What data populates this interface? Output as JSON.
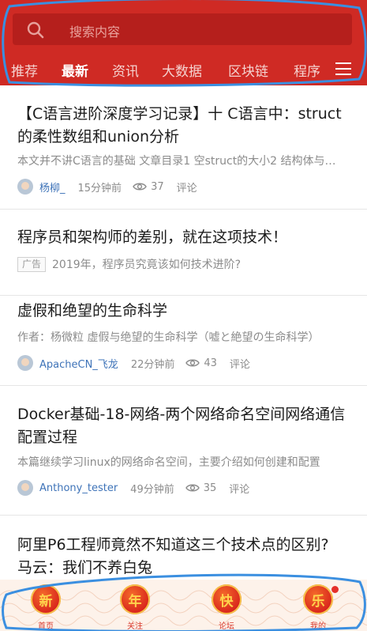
{
  "search": {
    "placeholder": "搜索内容"
  },
  "tabs": [
    "推荐",
    "最新",
    "资讯",
    "大数据",
    "区块链",
    "程序"
  ],
  "active_tab": "最新",
  "feed": [
    {
      "title": "【C语言进阶深度学习记录】十 C语言中：struct的柔性数组和union分析",
      "summary": "本文并不讲C语言的基础 文章目录1 空struct的大小2 结构体与柔性数组",
      "author": "杨柳_",
      "time": "15分钟前",
      "views": "37",
      "comment": "评论"
    },
    {
      "title": "程序员和架构师的差别，就在这项技术！",
      "ad_label": "广告",
      "summary": "2019年，程序员究竟该如何技术进阶?"
    },
    {
      "title": "虚假和绝望的生命科学",
      "summary": "作者：杨微粒 虚假与绝望的生命科学（嘘と絶望の生命科学）",
      "author": "ApacheCN_飞龙",
      "time": "22分钟前",
      "views": "43",
      "comment": "评论"
    },
    {
      "title": "Docker基础-18-网络-两个网络命名空间网络通信配置过程",
      "summary": "本篇继续学习linux的网络命名空间，主要介绍如何创建和配置",
      "author": "Anthony_tester",
      "time": "49分钟前",
      "views": "35",
      "comment": "评论"
    },
    {
      "title": "阿里P6工程师竟然不知道这三个技术点的区别? 马云：我们不养白兔"
    }
  ],
  "bottom_nav": [
    {
      "char": "新",
      "label": "首页"
    },
    {
      "char": "年",
      "label": "关注"
    },
    {
      "char": "快",
      "label": "论坛"
    },
    {
      "char": "乐",
      "label": "我的"
    }
  ],
  "colors": {
    "header": "#cf2a24",
    "search_bg": "#b51f1c",
    "author": "#3e73b8",
    "annotation": "#3b8fe0"
  }
}
